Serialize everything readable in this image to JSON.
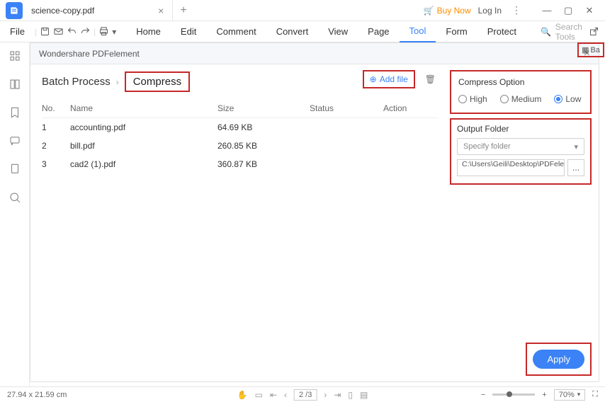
{
  "titlebar": {
    "doc_name": "science-copy.pdf",
    "buy_now": "Buy Now",
    "login": "Log In"
  },
  "menubar": {
    "file": "File",
    "items": [
      "Home",
      "Edit",
      "Comment",
      "Convert",
      "View",
      "Page",
      "Tool",
      "Form",
      "Protect"
    ],
    "active_index": 6,
    "search_placeholder": "Search Tools"
  },
  "dialog": {
    "title": "Wondershare PDFelement",
    "batch_label": "Batch Process",
    "tab": "Compress",
    "add_file": "Add file",
    "columns": {
      "no": "No.",
      "name": "Name",
      "size": "Size",
      "status": "Status",
      "action": "Action"
    },
    "files": [
      {
        "no": "1",
        "name": "accounting.pdf",
        "size": "64.69 KB"
      },
      {
        "no": "2",
        "name": "bill.pdf",
        "size": "260.85 KB"
      },
      {
        "no": "3",
        "name": "cad2 (1).pdf",
        "size": "360.87 KB"
      }
    ],
    "compress_option": {
      "title": "Compress Option",
      "high": "High",
      "medium": "Medium",
      "low": "Low",
      "selected": "low"
    },
    "output": {
      "title": "Output Folder",
      "dropdown": "Specify folder",
      "path": "C:\\Users\\Geili\\Desktop\\PDFelement\\Op",
      "browse": "..."
    },
    "apply": "Apply"
  },
  "right_rail": {
    "ba": "Ba"
  },
  "statusbar": {
    "dims": "27.94 x 21.59 cm",
    "page": "2 /3",
    "zoom": "70%"
  }
}
